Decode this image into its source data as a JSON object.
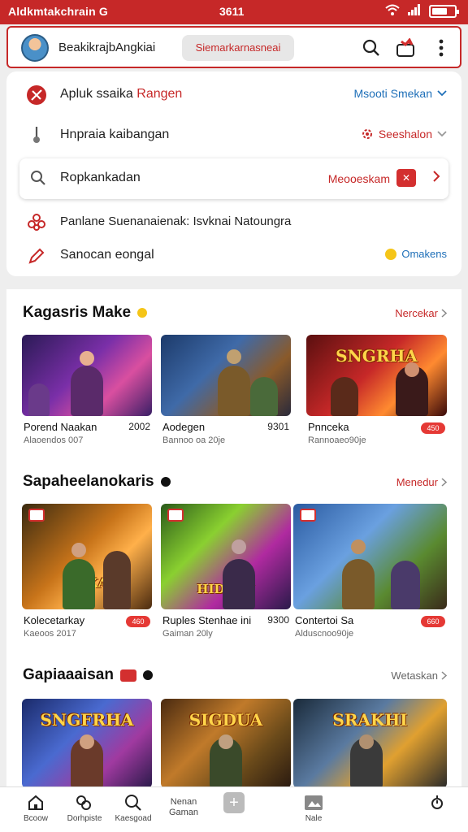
{
  "status_bar": {
    "left_text": "Aldkmtakchrain G",
    "time": "3611",
    "battery_percent": 70
  },
  "app_bar": {
    "title": "BeakikrajbAngkiai",
    "filter_label": "Siemarkarnasneai"
  },
  "options": [
    {
      "label": "Apluk ssaika",
      "label_accent": "Rangen",
      "value": "Msooti Smekan",
      "value_color": "#1e6fb8",
      "icon": "sword-emblem-icon"
    },
    {
      "label": "Hnpraia kaibangan",
      "value": "Seeshalon",
      "value_color": "#c62828",
      "icon": "joystick-icon"
    },
    {
      "label": "Ropkankadan",
      "value": "Meooeskam",
      "value_color": "#c62828",
      "icon": "search-icon"
    },
    {
      "label": "Panlane Suenanaienak: Isvknai Natoungra",
      "icon": "flower-icon"
    },
    {
      "label": "Sanocan eongal",
      "value": "Omakens",
      "value_color": "#1e6fb8",
      "icon": "pen-icon"
    }
  ],
  "sections": [
    {
      "title": "Kagasris Make",
      "see_all": "Nercekar",
      "games": [
        {
          "name": "Porend Naakan",
          "meta": "Alaoendos 007",
          "score": "2002",
          "logo": ""
        },
        {
          "name": "Aodegen",
          "meta": "Bannoo oa 20je",
          "score": "9301",
          "logo": ""
        },
        {
          "name": "Pnnceka",
          "meta": "Rannoaeo90je",
          "badge": "450",
          "logo": "SNGRHA"
        }
      ]
    },
    {
      "title": "Sapaheelanokaris",
      "see_all": "Menedur",
      "games": [
        {
          "name": "Kolecetarkay",
          "meta": "Kaeoos 2017",
          "badge": "460",
          "logo": "UAKA"
        },
        {
          "name": "Ruples Stenhae ini",
          "meta": "Gaiman 20ly",
          "score": "9300",
          "logo": "HIDARU"
        },
        {
          "name": "Contertoi Sa",
          "meta": "Alduscnoo90je",
          "badge": "660",
          "logo": ""
        }
      ]
    },
    {
      "title": "Gapiaaaisan",
      "see_all": "Wetaskan",
      "games": [
        {
          "name": "",
          "meta": "",
          "logo": "SNGFRHA"
        },
        {
          "name": "",
          "meta": "",
          "logo": "SIGDUA"
        },
        {
          "name": "",
          "meta": "",
          "logo": "SRAKHI"
        }
      ]
    }
  ],
  "bottom_nav": [
    {
      "label": "Bcoow",
      "icon": "home-icon"
    },
    {
      "label": "Dorhpiste",
      "icon": "controller-icon"
    },
    {
      "label": "Kaesgoad",
      "icon": "search-icon"
    },
    {
      "label": "Nenan Gaman",
      "icon": ""
    },
    {
      "label": "",
      "icon": "add-icon"
    },
    {
      "label": "Nale",
      "icon": "image-icon"
    },
    {
      "label": "",
      "icon": "alarm-icon"
    }
  ],
  "colors": {
    "accent": "#c62828",
    "link_blue": "#1e6fb8"
  }
}
